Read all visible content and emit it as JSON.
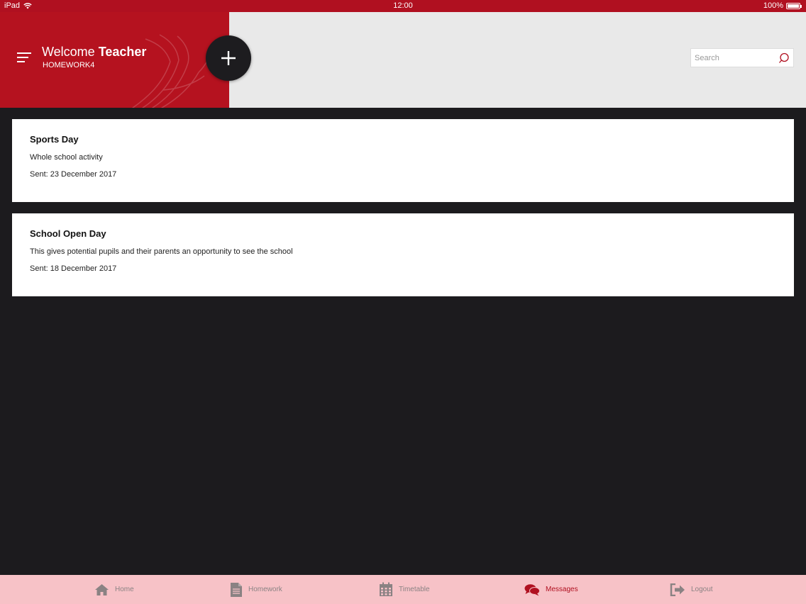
{
  "status_bar": {
    "device": "iPad",
    "time": "12:00",
    "battery": "100%"
  },
  "header": {
    "welcome_prefix": "Welcome",
    "welcome_name": "Teacher",
    "school_code": "HOMEWORK4",
    "brand_color": "#b5121f"
  },
  "search": {
    "placeholder": "Search",
    "value": ""
  },
  "messages": [
    {
      "title": "Sports Day",
      "description": "Whole school activity",
      "sent": "Sent: 23 December 2017"
    },
    {
      "title": "School Open Day",
      "description": "This gives potential pupils and their parents an opportunity to see the school",
      "sent": "Sent: 18 December 2017"
    }
  ],
  "tabs": [
    {
      "label": "Home",
      "icon": "home-icon",
      "active": false
    },
    {
      "label": "Homework",
      "icon": "document-icon",
      "active": false
    },
    {
      "label": "Timetable",
      "icon": "calendar-icon",
      "active": false
    },
    {
      "label": "Messages",
      "icon": "chat-bubbles-icon",
      "active": true
    },
    {
      "label": "Logout",
      "icon": "logout-icon",
      "active": false
    }
  ]
}
